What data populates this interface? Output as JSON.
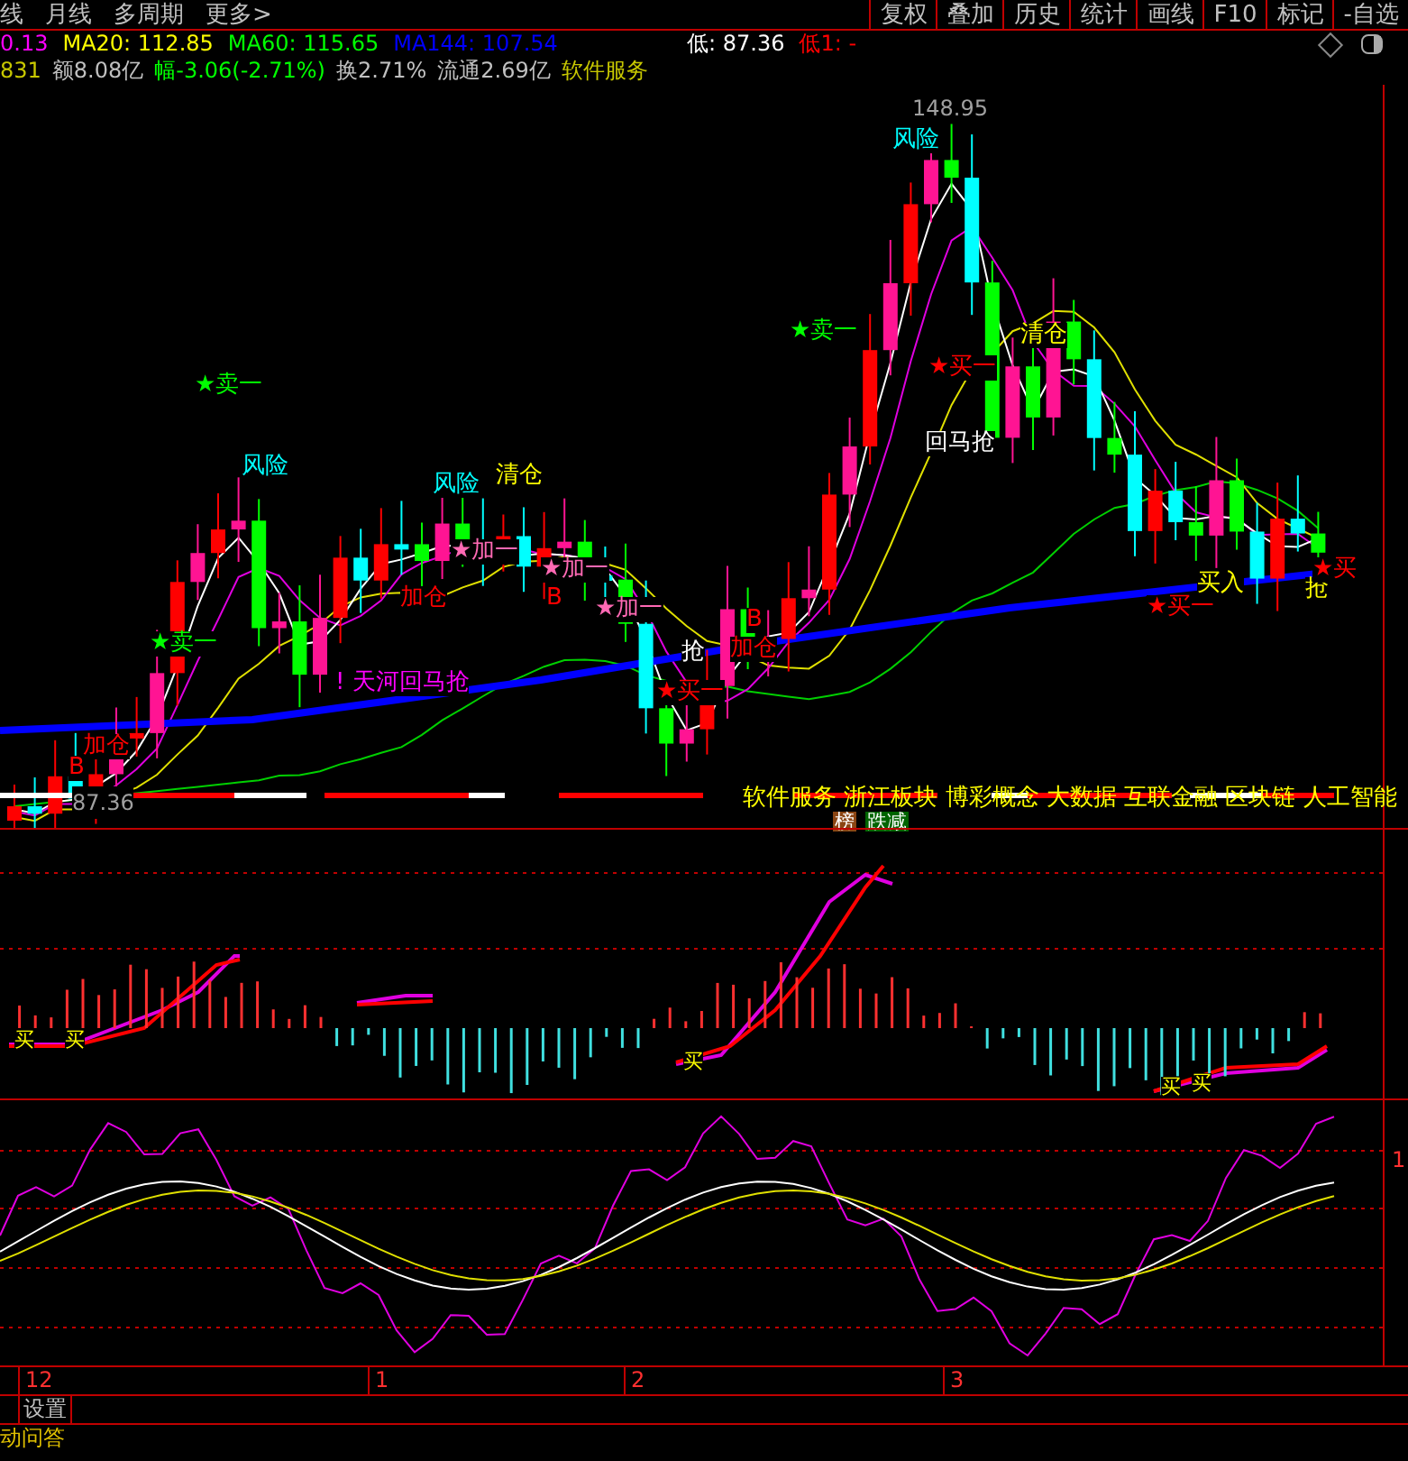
{
  "top_bar": {
    "period_tabs": [
      "线",
      "月线",
      "多周期",
      "更多>"
    ],
    "buttons": [
      "复权",
      "叠加",
      "历史",
      "统计",
      "画线",
      "F10",
      "标记",
      "-自选"
    ]
  },
  "indicator_line": [
    {
      "text": "0.13",
      "color": "#ff00ff"
    },
    {
      "text": "MA20: 112.85",
      "color": "#ffff00"
    },
    {
      "text": "MA60: 115.65",
      "color": "#00ff00"
    },
    {
      "text": "MA144: 107.54",
      "color": "#0000ff"
    }
  ],
  "low_info": [
    {
      "text": "低: 87.36",
      "color": "#ffffff"
    },
    {
      "text": "低1: -",
      "color": "#ff0000"
    }
  ],
  "quote_line": [
    {
      "text": "831",
      "color": "#c8c800"
    },
    {
      "text": "额8.08亿",
      "color": "#c0c0c0"
    },
    {
      "text": "幅-3.06(-2.71%)",
      "color": "#00ff00"
    },
    {
      "text": "换2.71%",
      "color": "#c0c0c0"
    },
    {
      "text": "流通2.69亿",
      "color": "#c0c0c0"
    },
    {
      "text": "软件服务",
      "color": "#c8c800"
    }
  ],
  "main_chart": {
    "high_label": "148.95",
    "low_label": "87.36",
    "signals": [
      {
        "text": "★卖一",
        "color": "#00ff00"
      },
      {
        "text": "风险",
        "color": "#00ffff"
      },
      {
        "text": "风险",
        "color": "#00ffff"
      },
      {
        "text": "清仓",
        "color": "#ffff00"
      },
      {
        "text": "★加一",
        "color": "#ff69b4"
      },
      {
        "text": "加仓",
        "color": "#ff0000"
      },
      {
        "text": "★加一",
        "color": "#ff69b4"
      },
      {
        "text": "B",
        "color": "#ff0000"
      },
      {
        "text": "★加一",
        "color": "#ff69b4"
      },
      {
        "text": "! 天河回马抢",
        "color": "#ff00ff"
      },
      {
        "text": "★卖一",
        "color": "#00ff00"
      },
      {
        "text": "加仓",
        "color": "#ff0000"
      },
      {
        "text": "B",
        "color": "#ff0000"
      },
      {
        "text": "抢",
        "color": "#ffffff"
      },
      {
        "text": "★买一",
        "color": "#ff0000"
      },
      {
        "text": "B",
        "color": "#ff0000"
      },
      {
        "text": "加仓",
        "color": "#ff0000"
      },
      {
        "text": "风险",
        "color": "#00ffff"
      },
      {
        "text": "★卖一",
        "color": "#00ff00"
      },
      {
        "text": "★买一",
        "color": "#ff0000"
      },
      {
        "text": "清仓",
        "color": "#ffff00"
      },
      {
        "text": "回马抢",
        "color": "#ffffff"
      },
      {
        "text": "买入",
        "color": "#ffff00"
      },
      {
        "text": "★买一",
        "color": "#ff0000"
      },
      {
        "text": "抢",
        "color": "#ffff00"
      },
      {
        "text": "★买",
        "color": "#ff0000"
      }
    ],
    "concept_tags": "软件服务 浙江板块 博彩概念 大数据 互联金融 区块链 人工智能",
    "badges": [
      {
        "text": "榜",
        "color": "#8b4513"
      },
      {
        "text": "跌减",
        "color": "#006400"
      }
    ]
  },
  "sub_chart_1": {
    "signals": [
      "买",
      "买",
      "买",
      "买",
      "买"
    ]
  },
  "sub_chart_2": {
    "axis_label": "1"
  },
  "time_axis": [
    "12",
    "1",
    "2",
    "3"
  ],
  "bottom_bar": {
    "buttons": [
      "设置"
    ],
    "link": "动问答"
  }
}
